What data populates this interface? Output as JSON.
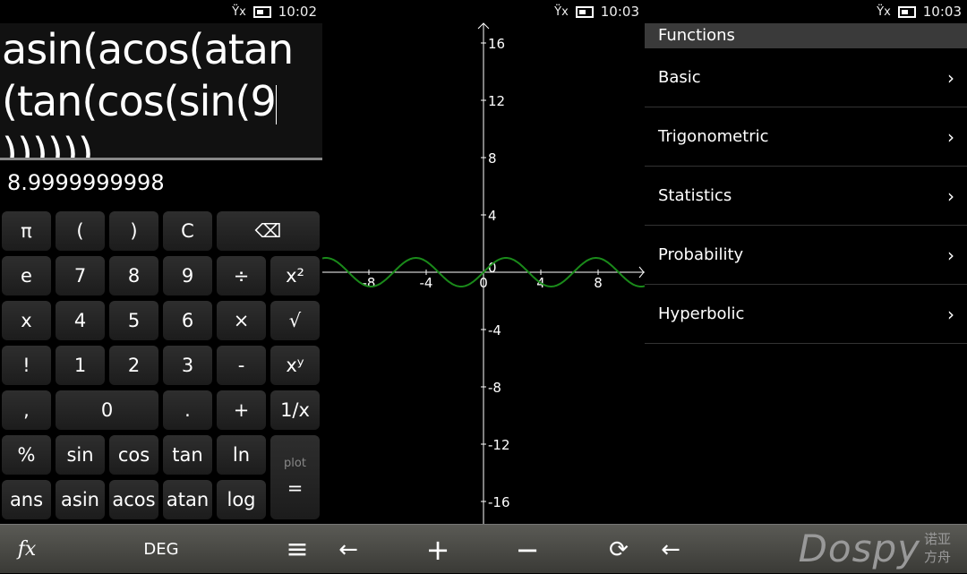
{
  "panels": [
    {
      "status": {
        "time": "10:02"
      },
      "expression": "asin(acos(atan(tan(cos(sin(9",
      "expression_tail": "))))))",
      "result": "8.9999999998",
      "keys": [
        [
          "π",
          "(",
          ")",
          "C",
          "⌫"
        ],
        [
          "e",
          "7",
          "8",
          "9",
          "÷",
          "x²"
        ],
        [
          "x",
          "4",
          "5",
          "6",
          "×",
          "√"
        ],
        [
          "!",
          "1",
          "2",
          "3",
          "-",
          "xʸ"
        ],
        [
          ",",
          "0",
          ".",
          "+",
          "1/x"
        ],
        [
          "%",
          "sin",
          "cos",
          "tan",
          "ln"
        ],
        [
          "ans",
          "asin",
          "acos",
          "atan",
          "log"
        ]
      ],
      "plot_label": "plot",
      "equals_label": "="
    },
    {
      "status": {
        "time": "10:03"
      },
      "chart_data": {
        "type": "line",
        "function": "sin(x)",
        "xlim": [
          -11.25,
          11.25
        ],
        "ylim": [
          -18,
          18
        ],
        "x_ticks": [
          -8,
          -4,
          0,
          4,
          8
        ],
        "y_ticks": [
          16,
          12,
          8,
          4,
          0,
          -4,
          -8,
          -12,
          -16
        ],
        "line_color": "#1a8a1a",
        "axis_color": "#ffffff"
      }
    },
    {
      "status": {
        "time": "10:03"
      },
      "header": "Functions",
      "items": [
        {
          "label": "Basic"
        },
        {
          "label": "Trigonometric"
        },
        {
          "label": "Statistics"
        },
        {
          "label": "Probability"
        },
        {
          "label": "Hyperbolic"
        }
      ]
    }
  ],
  "toolbar": {
    "fx": "fx",
    "mode": "DEG",
    "menu": "≡",
    "back": "←",
    "zoom_in": "+",
    "zoom_out": "−",
    "reset": "⟳",
    "back2": "←",
    "logo": "Dospy",
    "logo_cn": "诺亚方舟"
  }
}
